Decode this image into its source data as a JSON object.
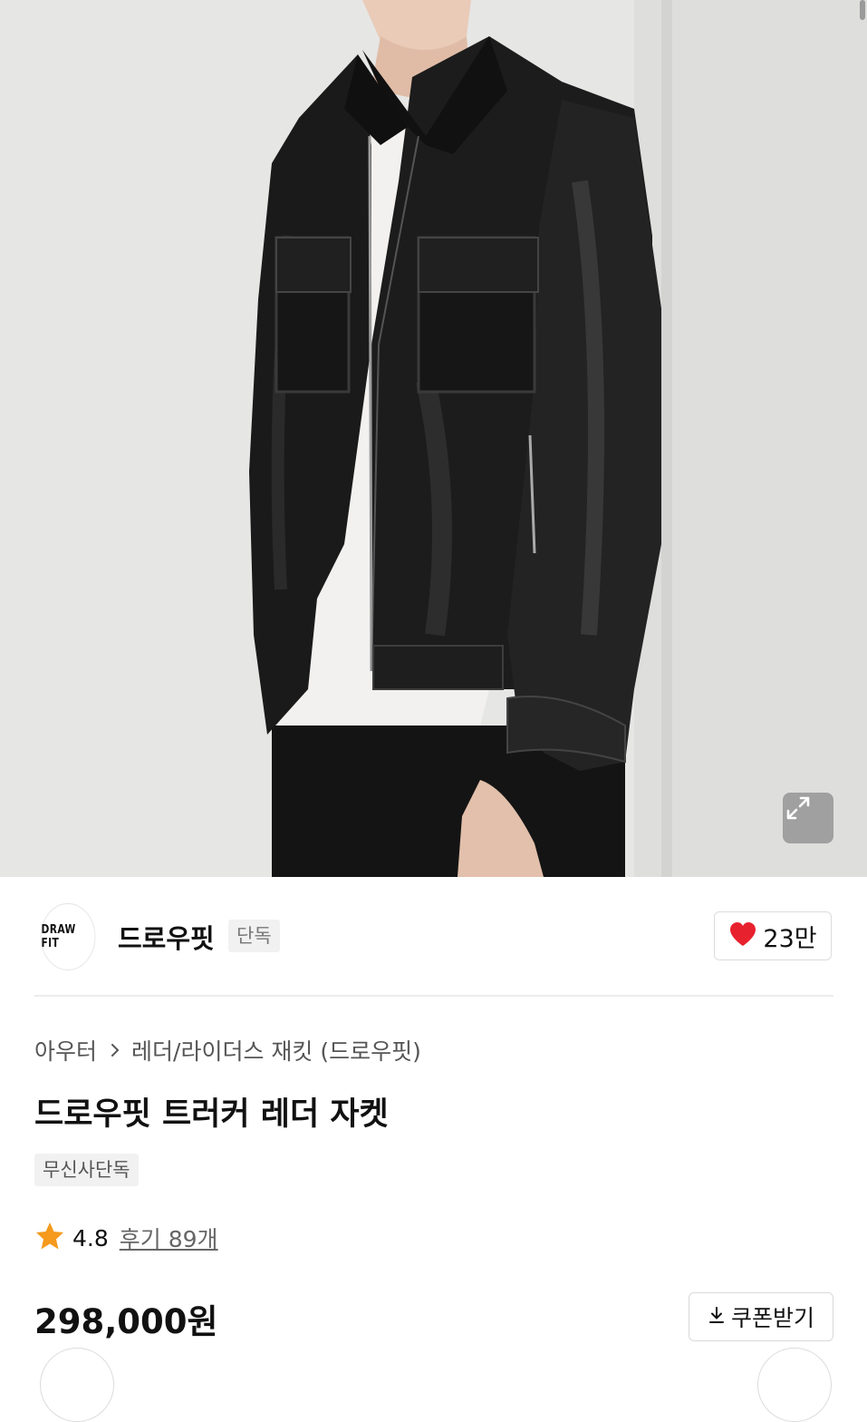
{
  "brand": {
    "logo_text": "DRAW FIT",
    "name": "드로우핏",
    "badge": "단독"
  },
  "like": {
    "count": "23만",
    "icon": "heart-icon"
  },
  "breadcrumb": {
    "category": "아우터",
    "subcategory": "레더/라이더스 재킷 (드로우핏)"
  },
  "product": {
    "title": "드로우핏 트러커 레더 자켓",
    "tag": "무신사단독"
  },
  "rating": {
    "score": "4.8",
    "review": "후기 89개",
    "icon": "star-icon"
  },
  "price": "298,000원",
  "coupon": {
    "label": "쿠폰받기",
    "icon": "download-icon"
  },
  "colors": {
    "heart": "#e8212e",
    "star": "#f59a1c",
    "image_bg": "#e4e4e3"
  }
}
